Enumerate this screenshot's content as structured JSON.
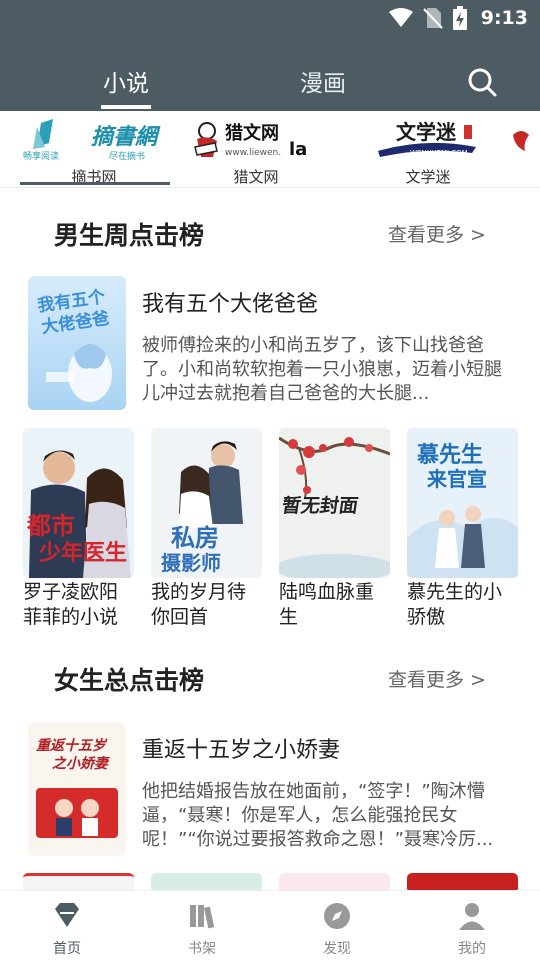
{
  "status": {
    "time": "9:13"
  },
  "header": {
    "tabs": [
      {
        "label": "小说",
        "active": true
      },
      {
        "label": "漫画",
        "active": false
      }
    ],
    "search_icon": "search-icon"
  },
  "sources": [
    {
      "name": "摘书网",
      "logo_text": "摘書網",
      "logo_sub": "畅享阅读 尽在摘书"
    },
    {
      "name": "猎文网",
      "logo_text": "猎文网",
      "logo_sub": "www.liewen.la",
      "logo_extra": ".la"
    },
    {
      "name": "文学迷",
      "logo_text": "文学迷",
      "logo_sub": "WENXUEMI.COM"
    }
  ],
  "male_section": {
    "title": "男生周点击榜",
    "more": "查看更多 >",
    "feature": {
      "title": "我有五个大佬爸爸",
      "desc": "被师傅捡来的小和尚五岁了，该下山找爸爸了。小和尚软软抱着一只小狼崽，迈着小短腿儿冲过去就抱着自己爸爸的大长腿..."
    },
    "books": [
      {
        "title": "罗子凌欧阳菲菲的小说",
        "cover_text": "都市少年医生"
      },
      {
        "title": "我的岁月待你回首",
        "cover_text": "私房摄影师"
      },
      {
        "title": "陆鸣血脉重生",
        "cover_text": "暂无封面"
      },
      {
        "title": "慕先生的小骄傲",
        "cover_text": "慕先生来官宣"
      }
    ]
  },
  "female_section": {
    "title": "女生总点击榜",
    "more": "查看更多 >",
    "feature": {
      "title": "重返十五岁之小娇妻",
      "desc": "他把结婚报告放在她面前，“签字！”陶沐懵逼，“聂寒！你是军人，怎么能强抢民女呢！”“你说过要报答救命之恩！”聂寒冷厉...",
      "cover_text": "重返十五岁之小娇妻"
    }
  },
  "bottom_nav": [
    {
      "label": "首页",
      "icon": "home-icon",
      "active": true
    },
    {
      "label": "书架",
      "icon": "bookshelf-icon",
      "active": false
    },
    {
      "label": "发现",
      "icon": "compass-icon",
      "active": false
    },
    {
      "label": "我的",
      "icon": "user-icon",
      "active": false
    }
  ],
  "colors": {
    "header": "#4d5b62",
    "accent": "#4d5b62"
  }
}
